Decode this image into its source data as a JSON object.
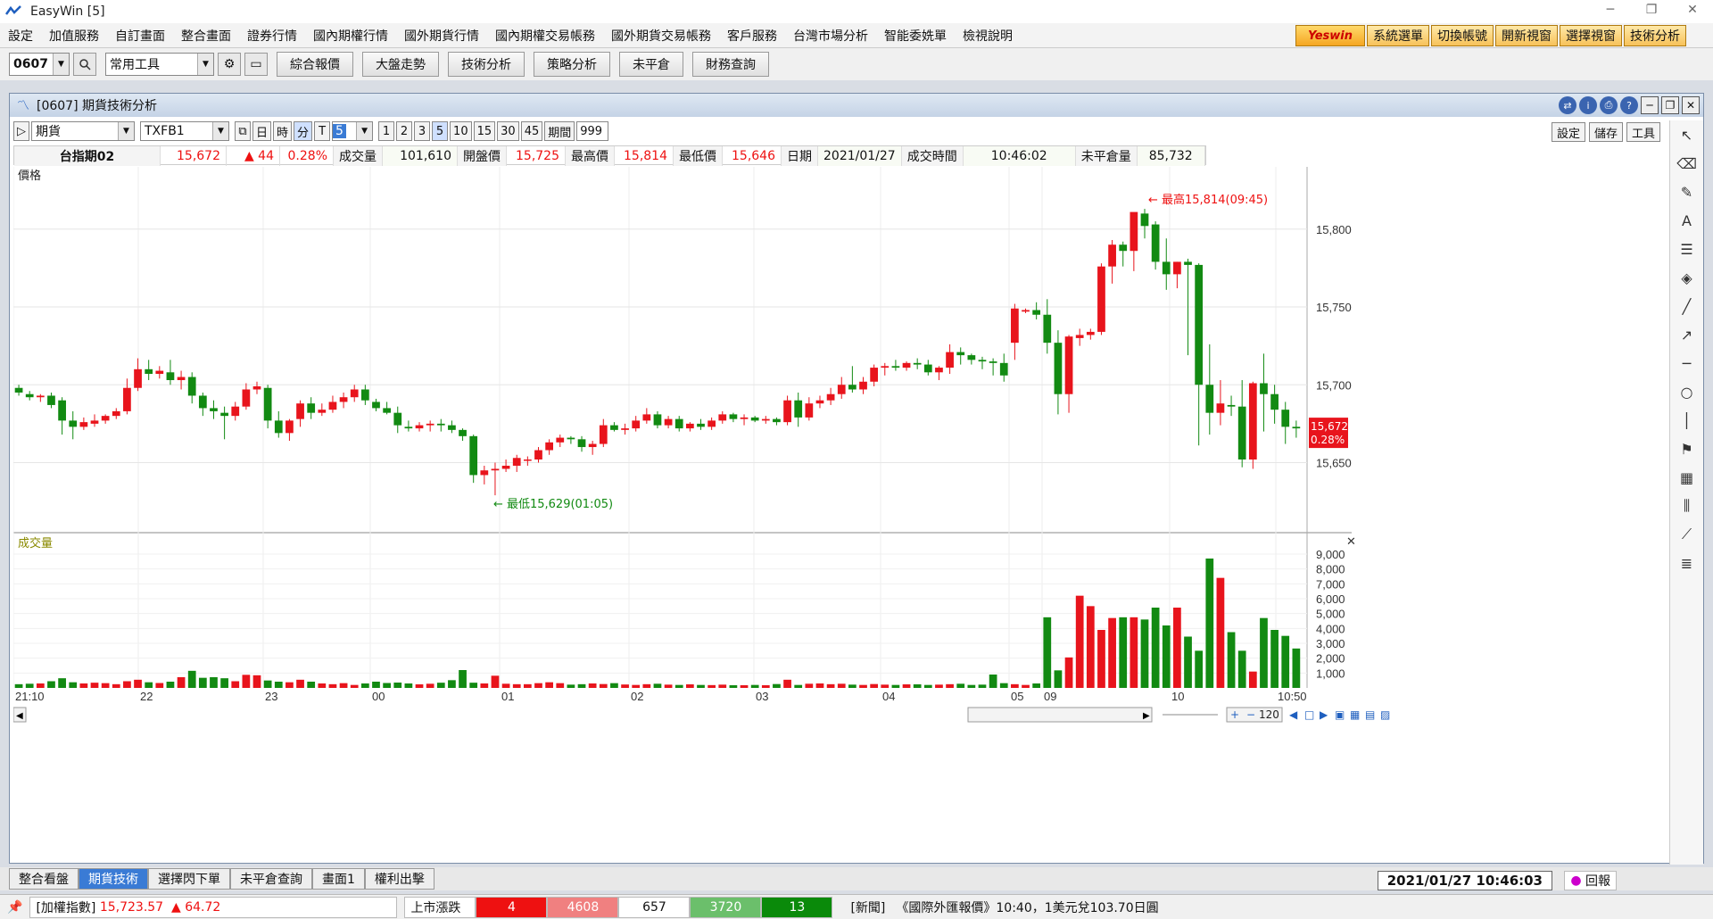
{
  "app": {
    "title": "EasyWin  [5]"
  },
  "menu": [
    "設定",
    "加值服務",
    "自訂畫面",
    "整合畫面",
    "證券行情",
    "國內期權行情",
    "國外期貨行情",
    "國內期權交易帳務",
    "國外期貨交易帳務",
    "客戶服務",
    "台灣市場分析",
    "智能委姺單",
    "檢視說明"
  ],
  "quick": {
    "brand": "Yeswin",
    "buttons": [
      "系統選單",
      "切換帳號",
      "開新視窗",
      "選擇視窗",
      "技術分析"
    ]
  },
  "toolbar": {
    "code": "0607",
    "tools": "常用工具",
    "buttons": [
      "綜合報價",
      "大盤走勢",
      "技術分析",
      "策略分析",
      "未平倉",
      "財務查詢"
    ]
  },
  "window": {
    "title": "[0607] 期貨技術分析"
  },
  "controls": {
    "market": "期貨",
    "symbol": "TXFB1",
    "periods": [
      "日",
      "時",
      "分",
      "T"
    ],
    "minute": "5",
    "nums": [
      "1",
      "2",
      "3",
      "5",
      "10",
      "15",
      "30",
      "45"
    ],
    "period_label": "期間",
    "period_value": "999",
    "right": [
      "設定",
      "儲存",
      "工具"
    ]
  },
  "quote": {
    "name": "台指期02",
    "price": "15,672",
    "change": "▲ 44",
    "pct": "0.28%",
    "vol_label": "成交量",
    "vol": "101,610",
    "open_label": "開盤價",
    "open": "15,725",
    "high_label": "最高價",
    "high": "15,814",
    "low_label": "最低價",
    "low": "15,646",
    "date_label": "日期",
    "date": "2021/01/27",
    "time_label": "成交時間",
    "time": "10:46:02",
    "oi_label": "未平倉量",
    "oi": "85,732"
  },
  "chart_data": {
    "type": "candlestick",
    "price_label": "價格",
    "volume_label": "成交量",
    "price_ticks": [
      15650,
      15700,
      15750,
      15800
    ],
    "price_ylim": [
      15605,
      15840
    ],
    "vol_ticks": [
      "1,000",
      "2,000",
      "3,000",
      "4,000",
      "5,000",
      "6,000",
      "7,000",
      "8,000",
      "9,000"
    ],
    "vol_ylim": [
      0,
      9600
    ],
    "x_labels": [
      "21:10",
      "22",
      "23",
      "00",
      "01",
      "02",
      "03",
      "04",
      "05",
      "09",
      "10",
      "10:50"
    ],
    "annotations": [
      "最高15,814(09:45)",
      "最低15,629(01:05)"
    ],
    "last": {
      "price": "15,672",
      "pct": "0.28%"
    },
    "range_box": "120",
    "candles": [
      [
        15698,
        15700,
        15693,
        15695
      ],
      [
        15694,
        15696,
        15690,
        15692
      ],
      [
        15692,
        15694,
        15689,
        15693
      ],
      [
        15693,
        15695,
        15685,
        15687
      ],
      [
        15690,
        15692,
        15668,
        15677
      ],
      [
        15677,
        15683,
        15665,
        15673
      ],
      [
        15673,
        15679,
        15671,
        15676
      ],
      [
        15675,
        15681,
        15673,
        15677
      ],
      [
        15677,
        15681,
        15675,
        15680
      ],
      [
        15680,
        15685,
        15678,
        15683
      ],
      [
        15683,
        15704,
        15681,
        15698
      ],
      [
        15698,
        15717,
        15696,
        15710
      ],
      [
        15710,
        15716,
        15703,
        15707
      ],
      [
        15707,
        15712,
        15704,
        15709
      ],
      [
        15708,
        15716,
        15700,
        15703
      ],
      [
        15703,
        15709,
        15697,
        15705
      ],
      [
        15705,
        15708,
        15688,
        15693
      ],
      [
        15693,
        15695,
        15680,
        15685
      ],
      [
        15685,
        15690,
        15678,
        15683
      ],
      [
        15682,
        15686,
        15665,
        15680
      ],
      [
        15680,
        15689,
        15677,
        15686
      ],
      [
        15686,
        15701,
        15684,
        15697
      ],
      [
        15697,
        15702,
        15694,
        15699
      ],
      [
        15698,
        15700,
        15672,
        15677
      ],
      [
        15677,
        15683,
        15666,
        15669
      ],
      [
        15669,
        15678,
        15664,
        15677
      ],
      [
        15678,
        15690,
        15673,
        15688
      ],
      [
        15688,
        15692,
        15678,
        15682
      ],
      [
        15682,
        15688,
        15680,
        15684
      ],
      [
        15684,
        15693,
        15682,
        15689
      ],
      [
        15689,
        15695,
        15685,
        15692
      ],
      [
        15692,
        15700,
        15689,
        15697
      ],
      [
        15697,
        15700,
        15687,
        15690
      ],
      [
        15689,
        15691,
        15683,
        15685
      ],
      [
        15685,
        15689,
        15681,
        15682
      ],
      [
        15682,
        15686,
        15669,
        15674
      ],
      [
        15673,
        15677,
        15670,
        15672
      ],
      [
        15672,
        15676,
        15670,
        15674
      ],
      [
        15674,
        15677,
        15670,
        15675
      ],
      [
        15675,
        15678,
        15670,
        15674
      ],
      [
        15674,
        15677,
        15669,
        15671
      ],
      [
        15671,
        15672,
        15664,
        15667
      ],
      [
        15667,
        15668,
        15637,
        15642
      ],
      [
        15642,
        15648,
        15636,
        15645
      ],
      [
        15645,
        15650,
        15629,
        15646
      ],
      [
        15646,
        15652,
        15644,
        15648
      ],
      [
        15648,
        15655,
        15644,
        15653
      ],
      [
        15652,
        15654,
        15648,
        15652
      ],
      [
        15652,
        15660,
        15650,
        15658
      ],
      [
        15658,
        15665,
        15655,
        15663
      ],
      [
        15663,
        15668,
        15660,
        15666
      ],
      [
        15666,
        15667,
        15662,
        15665
      ],
      [
        15665,
        15667,
        15657,
        15660
      ],
      [
        15660,
        15664,
        15655,
        15662
      ],
      [
        15662,
        15678,
        15660,
        15674
      ],
      [
        15674,
        15676,
        15670,
        15671
      ],
      [
        15671,
        15675,
        15668,
        15672
      ],
      [
        15672,
        15680,
        15670,
        15677
      ],
      [
        15677,
        15685,
        15675,
        15681
      ],
      [
        15681,
        15683,
        15672,
        15674
      ],
      [
        15674,
        15680,
        15672,
        15678
      ],
      [
        15678,
        15680,
        15670,
        15672
      ],
      [
        15672,
        15676,
        15670,
        15675
      ],
      [
        15675,
        15678,
        15671,
        15673
      ],
      [
        15673,
        15679,
        15671,
        15677
      ],
      [
        15677,
        15683,
        15675,
        15681
      ],
      [
        15681,
        15682,
        15676,
        15678
      ],
      [
        15678,
        15681,
        15674,
        15679
      ],
      [
        15679,
        15680,
        15676,
        15677
      ],
      [
        15677,
        15680,
        15675,
        15678
      ],
      [
        15678,
        15679,
        15674,
        15676
      ],
      [
        15676,
        15693,
        15674,
        15690
      ],
      [
        15690,
        15695,
        15673,
        15679
      ],
      [
        15679,
        15692,
        15677,
        15688
      ],
      [
        15688,
        15693,
        15685,
        15690
      ],
      [
        15690,
        15698,
        15687,
        15694
      ],
      [
        15694,
        15705,
        15691,
        15700
      ],
      [
        15700,
        15712,
        15695,
        15697
      ],
      [
        15697,
        15705,
        15694,
        15702
      ],
      [
        15702,
        15713,
        15699,
        15711
      ],
      [
        15711,
        15714,
        15706,
        15712
      ],
      [
        15712,
        15716,
        15709,
        15711
      ],
      [
        15711,
        15715,
        15709,
        15714
      ],
      [
        15714,
        15717,
        15710,
        15713
      ],
      [
        15713,
        15716,
        15706,
        15708
      ],
      [
        15708,
        15712,
        15703,
        15711
      ],
      [
        15711,
        15726,
        15707,
        15721
      ],
      [
        15721,
        15724,
        15713,
        15719
      ],
      [
        15719,
        15720,
        15713,
        15716
      ],
      [
        15716,
        15718,
        15710,
        15715
      ],
      [
        15715,
        15717,
        15706,
        15714
      ],
      [
        15714,
        15720,
        15702,
        15706
      ],
      [
        15727,
        15752,
        15716,
        15749
      ],
      [
        15747,
        15749,
        15746,
        15748
      ],
      [
        15748,
        15753,
        15742,
        15745
      ],
      [
        15745,
        15755,
        15720,
        15727
      ],
      [
        15727,
        15735,
        15681,
        15694
      ],
      [
        15694,
        15732,
        15682,
        15731
      ],
      [
        15730,
        15736,
        15725,
        15732
      ],
      [
        15732,
        15736,
        15729,
        15734
      ],
      [
        15734,
        15778,
        15732,
        15776
      ],
      [
        15776,
        15793,
        15765,
        15790
      ],
      [
        15790,
        15792,
        15776,
        15786
      ],
      [
        15786,
        15809,
        15773,
        15811
      ],
      [
        15810,
        15813,
        15794,
        15802
      ],
      [
        15803,
        15805,
        15774,
        15779
      ],
      [
        15779,
        15794,
        15761,
        15771
      ],
      [
        15771,
        15779,
        15762,
        15779
      ],
      [
        15779,
        15781,
        15719,
        15777
      ],
      [
        15777,
        15778,
        15661,
        15700
      ],
      [
        15700,
        15726,
        15668,
        15682
      ],
      [
        15682,
        15703,
        15674,
        15688
      ],
      [
        15687,
        15693,
        15680,
        15686
      ],
      [
        15686,
        15703,
        15647,
        15652
      ],
      [
        15652,
        15702,
        15646,
        15701
      ],
      [
        15701,
        15720,
        15670,
        15694
      ],
      [
        15694,
        15700,
        15675,
        15684
      ],
      [
        15684,
        15689,
        15662,
        15673
      ],
      [
        15673,
        15677,
        15666,
        15672
      ]
    ],
    "volumes": [
      250,
      280,
      300,
      450,
      650,
      380,
      300,
      350,
      320,
      250,
      450,
      550,
      380,
      330,
      420,
      720,
      1150,
      680,
      720,
      650,
      450,
      880,
      850,
      500,
      420,
      380,
      550,
      420,
      300,
      250,
      320,
      200,
      300,
      420,
      330,
      360,
      300,
      240,
      280,
      350,
      520,
      1200,
      350,
      300,
      820,
      280,
      250,
      250,
      320,
      380,
      320,
      220,
      250,
      300,
      260,
      320,
      230,
      200,
      250,
      280,
      220,
      200,
      240,
      200,
      190,
      220,
      180,
      180,
      200,
      180,
      260,
      550,
      200,
      280,
      300,
      250,
      280,
      220,
      200,
      260,
      220,
      200,
      240,
      240,
      200,
      220,
      250,
      280,
      200,
      220,
      900,
      320,
      250,
      200,
      300,
      4750,
      1180,
      2050,
      6200,
      5500,
      3900,
      4700,
      4750,
      4750,
      4600,
      5400,
      4200,
      5400,
      3450,
      2500,
      8700,
      7400,
      3750,
      2500,
      1100,
      4700,
      3900,
      3500,
      2650,
      1600,
      800
    ]
  },
  "tabs": [
    "整合看盤",
    "期貨技術",
    "選擇閃下單",
    "未平倉查詢",
    "畫面1",
    "權利出擊"
  ],
  "datetime": "2021/01/27 10:46:03",
  "replay": "回報",
  "status": {
    "index_label": "[加權指數]",
    "index": "15,723.57",
    "index_chg": "▲ 64.72",
    "breadth_label": "上市漲跌",
    "b1": "4",
    "b2": "4608",
    "b3": "657",
    "b4": "3720",
    "b5": "13",
    "news": "[新聞]",
    "news_text": "《國際外匯報價》10:40，1美元兌103.70日圓"
  }
}
